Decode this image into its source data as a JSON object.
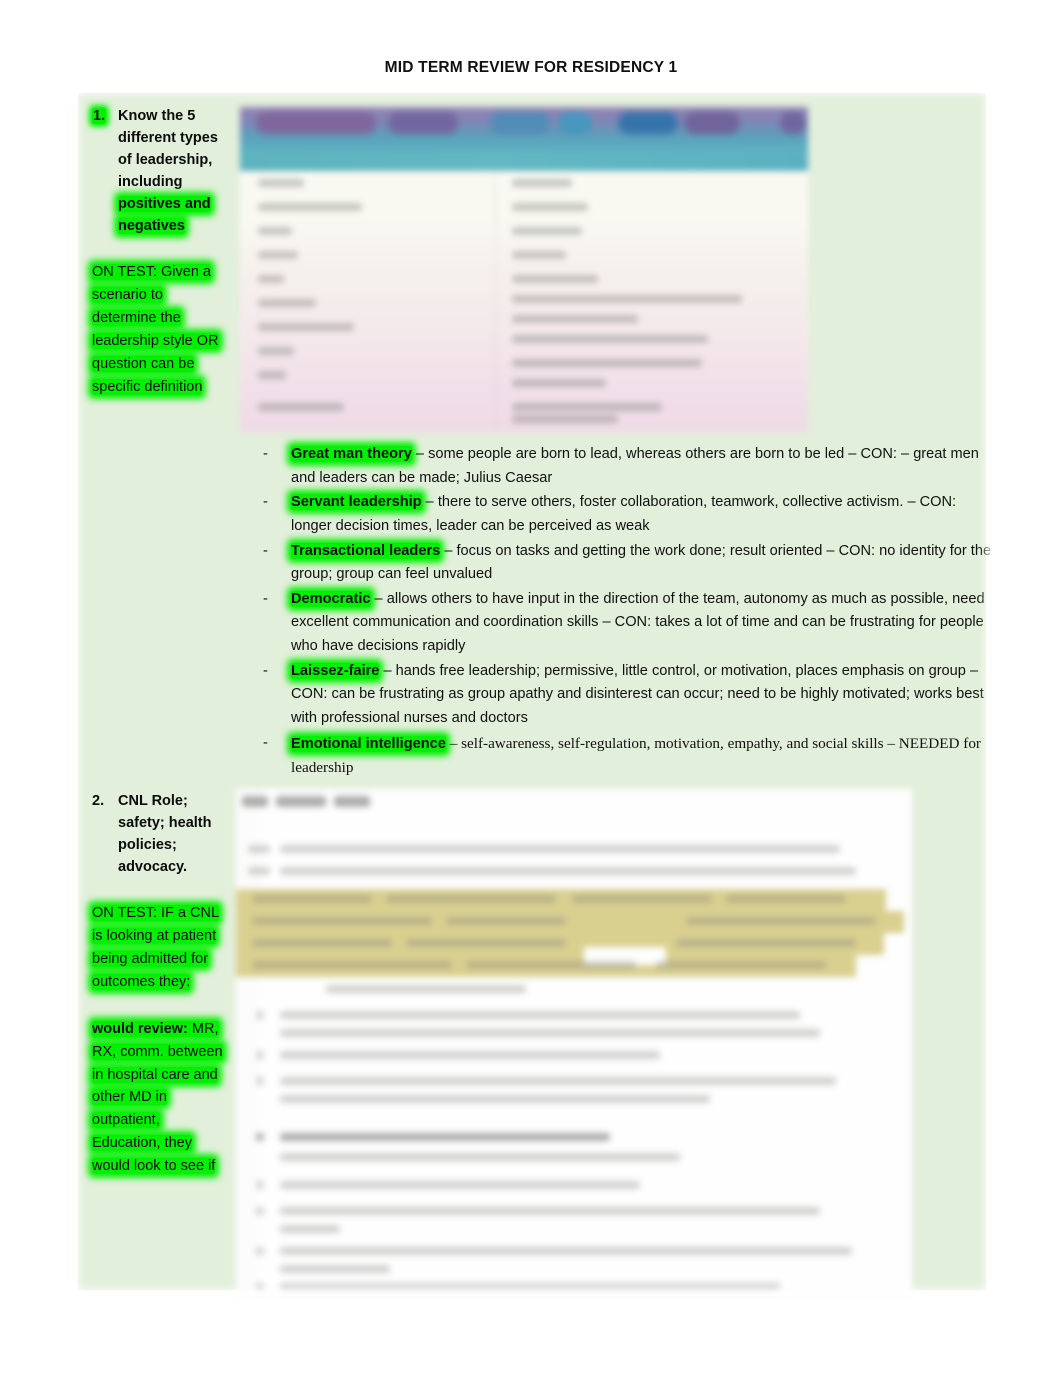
{
  "document": {
    "title": "MID TERM REVIEW FOR RESIDENCY 1"
  },
  "sections": [
    {
      "number": "1.",
      "heading_plain": "Know the 5 different types of leadership, including ",
      "heading_highlight": "positives and negatives",
      "note": "ON TEST: Given a scenario to determine the leadership style OR question can be specific definition",
      "embedded_image": {
        "kind": "leadership-styles-table-screenshot",
        "description": "Blurred screenshot of a leadership styles comparison table with a purple-to-teal gradient header row and cream-to-pink body rows",
        "header_colors": [
          "#8f7fb0",
          "#5f93b8",
          "#4fa6bd",
          "#2c6ea8"
        ],
        "body_colors": [
          "#fbfbf5",
          "#f5e8ec",
          "#efd9e7"
        ]
      },
      "bullets": [
        {
          "term": "Great man theory",
          "text": " – some people are born to lead, whereas others are born to be led – CON: – great men and leaders can be made; Julius Caesar",
          "font": "sans"
        },
        {
          "term": "Servant leadership",
          "text": " – there to serve others, foster collaboration, teamwork, collective activism. – CON: longer decision times, leader can be perceived as weak",
          "font": "sans"
        },
        {
          "term": "Transactional leaders",
          "text": " – focus on tasks and getting the work done; result oriented – CON: no identity for the group; group can feel unvalued",
          "font": "sans"
        },
        {
          "term": "Democratic",
          "text": " – allows others to have input in the direction of the team, autonomy as much as possible, need excellent communication and coordination skills – CON: takes a lot of time and can be frustrating for people who have decisions rapidly",
          "font": "sans"
        },
        {
          "term": "Laissez-faire",
          "text": " – hands free leadership; permissive, little control, or motivation, places emphasis on group – CON: can be frustrating as group apathy and disinterest can occur; need to be highly motivated; works best with professional nurses and doctors",
          "font": "sans"
        },
        {
          "term": "Emotional intelligence",
          "text": " – self-awareness, self-regulation, motivation, empathy, and social skills – NEEDED for leadership",
          "font": "serif"
        }
      ],
      "bullet_marker": "-"
    },
    {
      "number": "2.",
      "heading_plain": "CNL Role; safety; health policies; advocacy.",
      "note": "ON TEST: IF a CNL is looking at patient being admitted for outcomes they:",
      "note2_bold": "would review:",
      "note2": " MR, RX, comm. between in hospital care and other MD in outpatient, Education, they would look to see if",
      "embedded_image": {
        "kind": "cnl-role-document-screenshot",
        "description": "Blurred screenshot of a white text document with a khaki/olive highlighted paragraph and a numbered list below",
        "highlight_color": "#d9cf8c"
      }
    }
  ],
  "colors": {
    "page_background": "#ffffff",
    "content_block_background": "#e2efda",
    "highlight_green": "#00f000",
    "text": "#111111"
  }
}
